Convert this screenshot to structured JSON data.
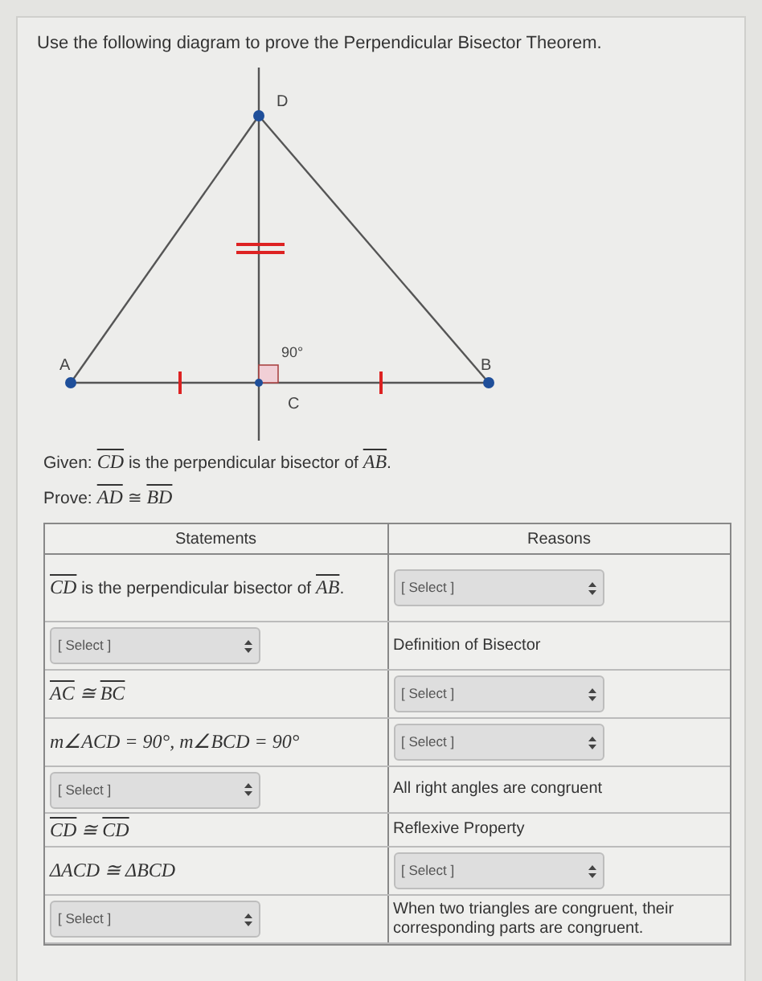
{
  "instruction": "Use the following diagram to prove the Perpendicular Bisector Theorem.",
  "diagram": {
    "points": [
      {
        "label": "D"
      },
      {
        "label": "A"
      },
      {
        "label": "B"
      },
      {
        "label": "C"
      }
    ],
    "angle_label": "90°"
  },
  "given": {
    "label": "Given:",
    "parts": [
      {
        "kind": "segment",
        "text": "CD"
      },
      {
        "kind": "plain",
        "text": " is the perpendicular bisector of "
      },
      {
        "kind": "segment",
        "text": "AB"
      },
      {
        "kind": "plain",
        "text": "."
      }
    ]
  },
  "prove": {
    "label": "Prove:",
    "parts": [
      {
        "kind": "segment",
        "text": "AD"
      },
      {
        "kind": "plain",
        "text": " ≅ "
      },
      {
        "kind": "segment",
        "text": "BD"
      }
    ]
  },
  "table": {
    "columns": [
      "Statements",
      "Reasons"
    ],
    "rows": [
      {
        "statement": {
          "kind": "text",
          "parts": [
            {
              "kind": "segment",
              "text": "CD"
            },
            {
              "kind": "plain",
              "text": " is the perpendicular bisector of "
            },
            {
              "kind": "segment",
              "text": "AB"
            },
            {
              "kind": "plain",
              "text": "."
            }
          ]
        },
        "reason": {
          "kind": "select",
          "placeholder": "[ Select ]"
        }
      },
      {
        "statement": {
          "kind": "select",
          "placeholder": "[ Select ]"
        },
        "reason": {
          "kind": "text",
          "text": "Definition of Bisector"
        }
      },
      {
        "statement": {
          "kind": "text",
          "parts": [
            {
              "kind": "segment",
              "text": "AC"
            },
            {
              "kind": "math",
              "text": " ≅ "
            },
            {
              "kind": "segment",
              "text": "BC"
            }
          ]
        },
        "reason": {
          "kind": "select",
          "placeholder": "[ Select ]"
        }
      },
      {
        "statement": {
          "kind": "text",
          "parts": [
            {
              "kind": "math",
              "text": "m∠ACD = 90°, m∠BCD = 90°"
            }
          ]
        },
        "reason": {
          "kind": "select",
          "placeholder": "[ Select ]"
        }
      },
      {
        "statement": {
          "kind": "select",
          "placeholder": "[ Select ]"
        },
        "reason": {
          "kind": "text",
          "text": "All right angles are congruent"
        }
      },
      {
        "statement": {
          "kind": "text",
          "parts": [
            {
              "kind": "segment",
              "text": "CD"
            },
            {
              "kind": "math",
              "text": " ≅ "
            },
            {
              "kind": "segment",
              "text": "CD"
            }
          ]
        },
        "reason": {
          "kind": "text",
          "text": "Reflexive Property"
        }
      },
      {
        "statement": {
          "kind": "text",
          "parts": [
            {
              "kind": "math",
              "text": "ΔACD ≅ ΔBCD"
            }
          ]
        },
        "reason": {
          "kind": "select",
          "placeholder": "[ Select ]"
        }
      },
      {
        "statement": {
          "kind": "select",
          "placeholder": "[ Select ]"
        },
        "reason": {
          "kind": "text",
          "text": "When two triangles are congruent, their corresponding parts are congruent."
        }
      }
    ]
  }
}
